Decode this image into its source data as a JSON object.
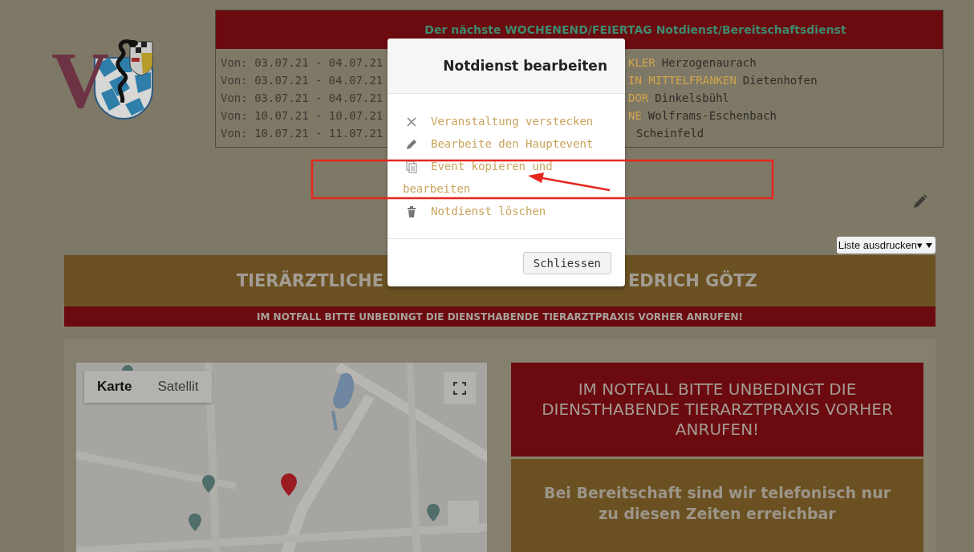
{
  "logo": {
    "letter": "V"
  },
  "notice": {
    "title": "Der nächste WOCHENEND/FEIERTAG Notdienst/Bereitschaftsdienst",
    "rows": [
      {
        "dates": "Von: 03.07.21 - 04.07.21",
        "name_fragment": "KLER",
        "place": "Herzogenaurach"
      },
      {
        "dates": "Von: 03.07.21 - 04.07.21",
        "name_fragment": "IN MITTELFRANKEN",
        "place": "Dietenhofen"
      },
      {
        "dates": "Von: 03.07.21 - 04.07.21",
        "name_fragment": "DOR",
        "place": "Dinkelsbühl"
      },
      {
        "dates": "Von: 10.07.21 - 10.07.21",
        "name_fragment": "NE",
        "place": "Wolframs-Eschenbach"
      },
      {
        "dates": "Von: 10.07.21 - 11.07.21",
        "place": "Scheinfeld"
      }
    ]
  },
  "print_select": {
    "value": "Liste ausdrucken▾"
  },
  "banner": {
    "title_left": "TIERÄRZTLICHE",
    "title_right": "EDRICH GÖTZ",
    "notice": "IM NOTFALL BITTE UNBEDINGT DIE DIENSTHABENDE TIERARZTPRAXIS VORHER ANRUFEN!"
  },
  "map": {
    "kind": "picture",
    "map_types": [
      {
        "label": "Karte",
        "selected": true
      },
      {
        "label": "Satellit",
        "selected": false
      }
    ]
  },
  "info": {
    "emergency": "IM NOTFALL BITTE UNBEDINGT DIE DIENSTHABENDE TIERARZTPRAXIS VORHER ANRUFEN!",
    "hours": "Bei Bereitschaft sind wir telefonisch nur zu diesen Zeiten erreichbar"
  },
  "dialog": {
    "title": "Notdienst bearbeiten",
    "actions": [
      {
        "kind": "hide",
        "label": "Veranstaltung verstecken"
      },
      {
        "kind": "edit",
        "label": "Bearbeite den Hauptevent"
      },
      {
        "kind": "copy",
        "label": "Event kopieren und bearbeiten"
      },
      {
        "kind": "delete",
        "label": "Notdienst löschen"
      }
    ],
    "close_button": "Schliessen"
  }
}
